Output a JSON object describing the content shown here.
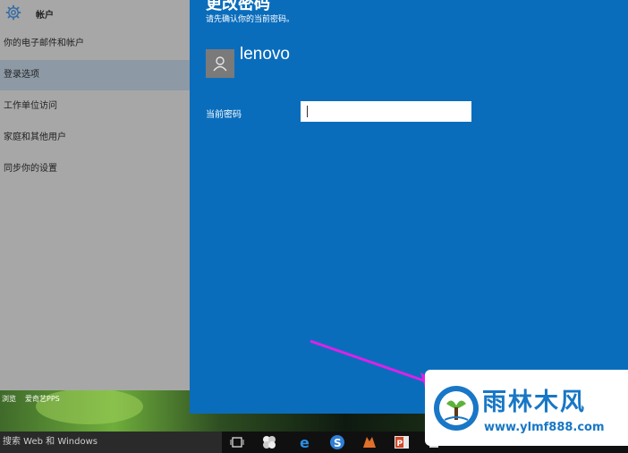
{
  "settings": {
    "title": "帐户",
    "items": [
      {
        "label": "你的电子邮件和帐户",
        "active": false
      },
      {
        "label": "登录选项",
        "active": true
      },
      {
        "label": "工作单位访问",
        "active": false
      },
      {
        "label": "家庭和其他用户",
        "active": false
      },
      {
        "label": "同步你的设置",
        "active": false
      }
    ]
  },
  "desktop": {
    "labels": [
      "浏览",
      "爱奇艺PPS"
    ]
  },
  "dialog": {
    "heading": "更改密码",
    "subtitle": "请先确认你的当前密码。",
    "username": "lenovo",
    "password_label": "当前密码",
    "password_value": ""
  },
  "taskbar": {
    "search_placeholder": "搜索 Web 和 Windows",
    "icons": [
      "task-view-icon",
      "app-pinwheel-icon",
      "edge-icon",
      "sogou-browser-icon",
      "firefox-icon",
      "powerpoint-icon",
      "store-icon"
    ]
  },
  "watermark": {
    "name": "雨林木风",
    "url": "www.ylmf888.com"
  },
  "colors": {
    "dialog_blue": "#0a6dbc",
    "settings_gray": "#a7a7a7",
    "arrow_magenta": "#e020e8",
    "watermark_blue": "#1877c6"
  }
}
